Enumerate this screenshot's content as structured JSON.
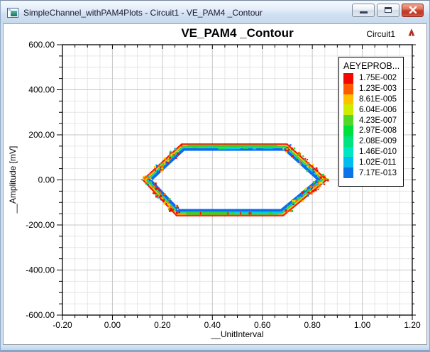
{
  "window": {
    "title": "SimpleChannel_withPAM4Plots - Circuit1 - VE_PAM4 _Contour"
  },
  "chart_data": {
    "type": "contour",
    "title": "VE_PAM4 _Contour",
    "annotation": "Circuit1",
    "xlabel": "__UnitInterval",
    "ylabel": "__Amplitude [mV]",
    "xlim": [
      -0.2,
      1.2
    ],
    "ylim": [
      -600,
      600
    ],
    "x_minor_step": 0.05,
    "y_minor_step": 50,
    "grid": true,
    "xticks": {
      "values": [
        -0.2,
        0.0,
        0.2,
        0.4,
        0.6,
        0.8,
        1.0,
        1.2
      ],
      "labels": [
        "-0.20",
        "0.00",
        "0.20",
        "0.40",
        "0.60",
        "0.80",
        "1.00",
        "1.20"
      ]
    },
    "yticks": {
      "values": [
        600,
        400,
        200,
        0,
        -200,
        -400,
        -600
      ],
      "labels": [
        "600.00",
        "400.00",
        "200.00",
        "0.00",
        "-200.00",
        "-400.00",
        "-600.00"
      ]
    },
    "legend": {
      "title": "AEYEPROB...",
      "position": "top-right",
      "entries": [
        {
          "label": "1.75E-002",
          "color": "#f20800"
        },
        {
          "label": "1.23E-003",
          "color": "#ff5a00"
        },
        {
          "label": "8.61E-005",
          "color": "#ffc000"
        },
        {
          "label": "6.04E-006",
          "color": "#cdec00"
        },
        {
          "label": "4.23E-007",
          "color": "#52d829"
        },
        {
          "label": "2.97E-008",
          "color": "#00e03a"
        },
        {
          "label": "2.08E-009",
          "color": "#00e37e"
        },
        {
          "label": "1.46E-010",
          "color": "#00e5c4"
        },
        {
          "label": "1.02E-011",
          "color": "#00bdee"
        },
        {
          "label": "7.17E-013",
          "color": "#0c74e8"
        }
      ]
    },
    "contour": {
      "vertices": [
        [
          0.118,
          0
        ],
        [
          0.276,
          162
        ],
        [
          0.7,
          162
        ],
        [
          0.862,
          0
        ],
        [
          0.684,
          -162
        ],
        [
          0.256,
          -162
        ]
      ],
      "rings": [
        {
          "color": "#ee1000",
          "width": 1.8
        },
        {
          "color": "#ff6a00",
          "width": 1.0
        },
        {
          "color": "#ffd300",
          "width": 1.0
        },
        {
          "color": "#2fd135",
          "width": 1.8
        },
        {
          "color": "#00cfe0",
          "width": 1.0
        },
        {
          "color": "#0a6bf0",
          "width": 3.8
        }
      ]
    }
  }
}
